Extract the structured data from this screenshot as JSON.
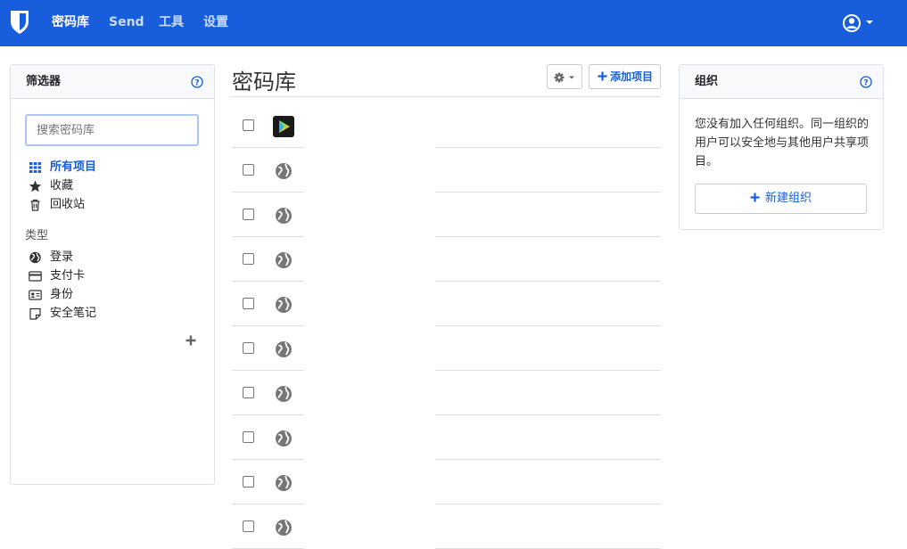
{
  "nav": {
    "brand_icon": "bitwarden-shield-icon",
    "items": [
      {
        "label": "密码库",
        "active": true
      },
      {
        "label": "Send",
        "active": false
      },
      {
        "label": "工具",
        "active": false
      },
      {
        "label": "设置",
        "active": false
      }
    ],
    "user_icon": "user-circle-icon"
  },
  "filters": {
    "title": "筛选器",
    "search_placeholder": "搜索密码库",
    "collections": [
      {
        "label": "所有项目",
        "icon": "grid-icon",
        "active": true
      },
      {
        "label": "收藏",
        "icon": "star-icon",
        "active": false
      },
      {
        "label": "回收站",
        "icon": "trash-icon",
        "active": false
      }
    ],
    "types_label": "类型",
    "types": [
      {
        "label": "登录",
        "icon": "globe-icon"
      },
      {
        "label": "支付卡",
        "icon": "credit-card-icon"
      },
      {
        "label": "身份",
        "icon": "id-card-icon"
      },
      {
        "label": "安全笔记",
        "icon": "note-icon"
      }
    ]
  },
  "vault": {
    "title": "密码库",
    "add_item_label": "添加项目",
    "items": [
      {
        "icon": "app-favicon-icon"
      },
      {
        "icon": "globe-icon"
      },
      {
        "icon": "globe-icon"
      },
      {
        "icon": "globe-icon"
      },
      {
        "icon": "globe-icon"
      },
      {
        "icon": "globe-icon"
      },
      {
        "icon": "globe-icon"
      },
      {
        "icon": "globe-icon"
      },
      {
        "icon": "globe-icon"
      },
      {
        "icon": "globe-icon"
      }
    ]
  },
  "organizations": {
    "title": "组织",
    "message": "您没有加入任何组织。同一组织的用户可以安全地与其他用户共享项目。",
    "new_org_label": "新建组织"
  },
  "colors": {
    "brand": "#175ddc",
    "border": "#dee2e6"
  }
}
